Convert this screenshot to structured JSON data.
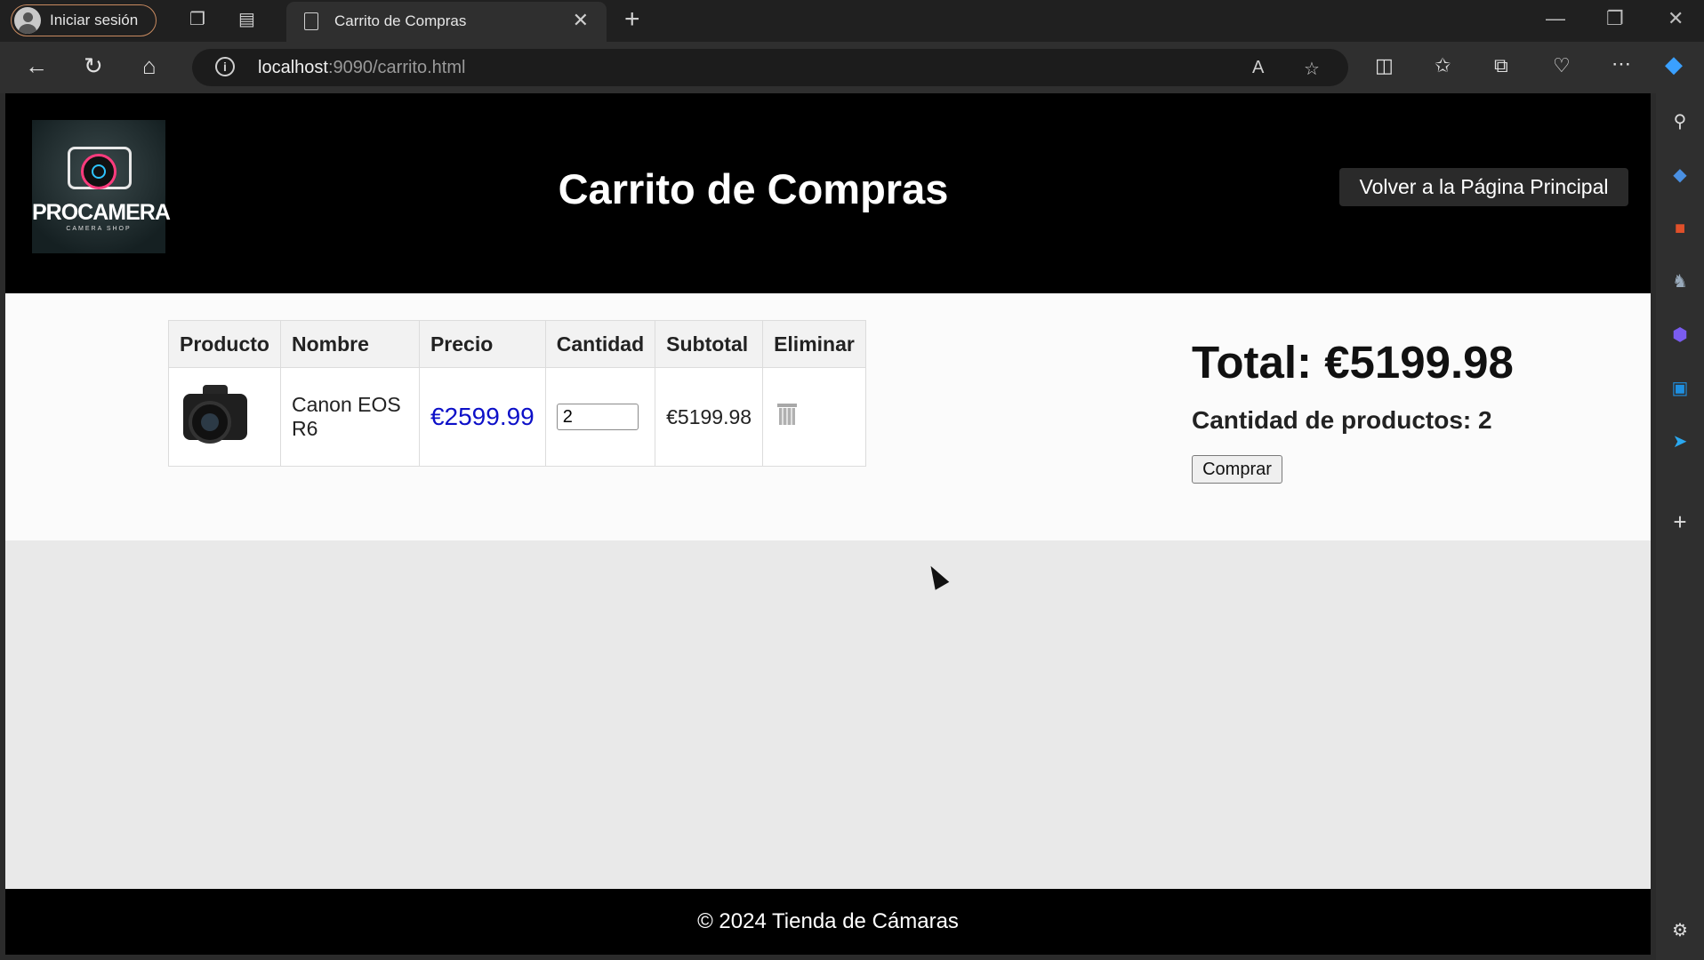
{
  "browser": {
    "profile_label": "Iniciar sesión",
    "tab_title": "Carrito de Compras",
    "url_host": "localhost",
    "url_rest": ":9090/carrito.html"
  },
  "site": {
    "logo_brand": "PROCAMERA",
    "logo_sub": "CAMERA SHOP",
    "title": "Carrito de Compras",
    "home_button": "Volver a la Página Principal"
  },
  "cart": {
    "headers": [
      "Producto",
      "Nombre",
      "Precio",
      "Cantidad",
      "Subtotal",
      "Eliminar"
    ],
    "rows": [
      {
        "name": "Canon EOS R6",
        "price": "€2599.99",
        "quantity": "2",
        "subtotal": "€5199.98"
      }
    ],
    "total_label": "Total: €5199.98",
    "count_label": "Cantidad de productos: 2",
    "buy_button": "Comprar"
  },
  "footer": {
    "text": "© 2024 Tienda de Cámaras"
  },
  "colors": {
    "price": "#0d10c8",
    "header_bg": "#000000",
    "tab_border": "#c88a60"
  }
}
